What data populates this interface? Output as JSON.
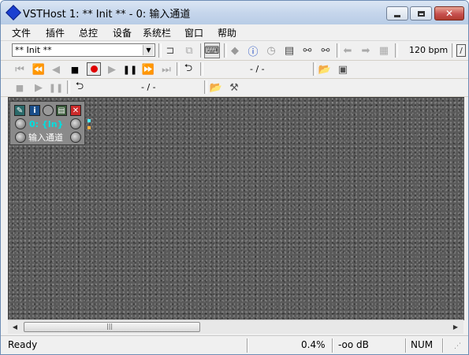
{
  "window": {
    "title": "VSTHost 1: ** Init ** - 0: 输入通道"
  },
  "caption_buttons": {
    "minimize": "–",
    "maximize": "□",
    "close": "✕"
  },
  "menu": [
    "文件",
    "插件",
    "总控",
    "设备",
    "系统栏",
    "窗口",
    "帮助"
  ],
  "toolbar1": {
    "preset": "** Init **",
    "tempo": "120 bpm",
    "icons": [
      "cut-icon",
      "copy-icon",
      "midi-keyboard-icon",
      "diamond-icon",
      "info-icon",
      "clock-icon",
      "properties-icon",
      "chain-icon",
      "chain-icon",
      "back-arrow-icon",
      "forward-arrow-icon",
      "bank-icon"
    ]
  },
  "toolbar2": {
    "position": "- / -"
  },
  "toolbar3": {
    "position": "- / -"
  },
  "plugin": {
    "name": "输入通道",
    "channel": "0: {In}"
  },
  "status": {
    "text": "Ready",
    "cpu": "0.4%",
    "level": "-oo dB",
    "num": "NUM"
  },
  "colors": {
    "record": "#e00000",
    "plugin_bg": "#8a8a8a",
    "canvas_bg": "#5a5a5a"
  }
}
